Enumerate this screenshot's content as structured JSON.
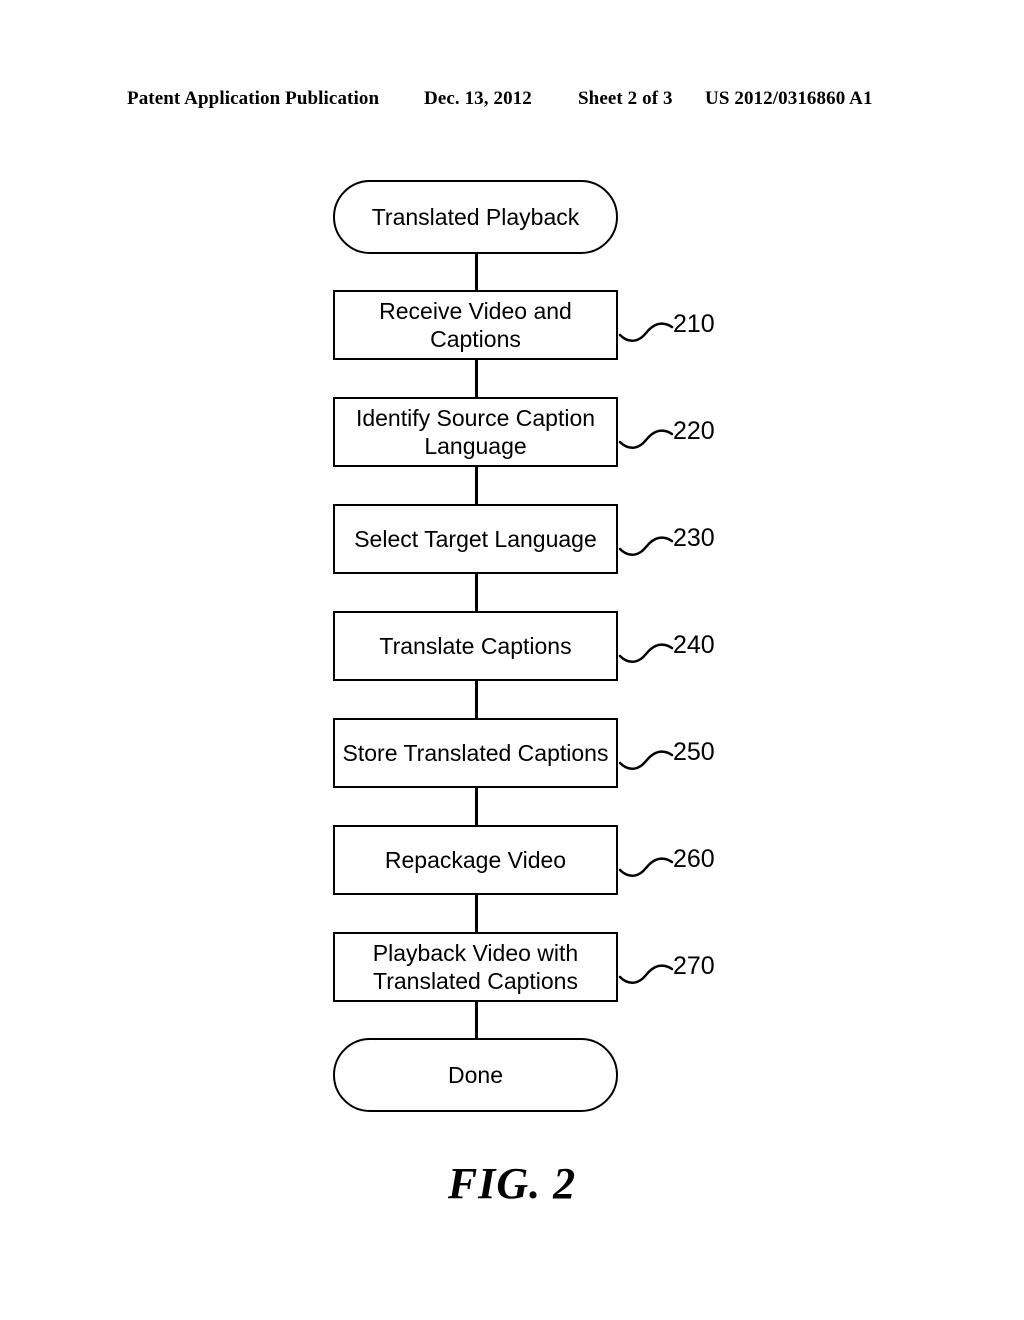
{
  "page": {
    "background_color": "#ffffff",
    "ink_color": "#000000"
  },
  "header": {
    "publication": "Patent Application Publication",
    "date": "Dec. 13, 2012",
    "sheet": "Sheet 2 of 3",
    "document_number": "US 2012/0316860 A1"
  },
  "figure": {
    "caption": "FIG. 2",
    "title": "Translated Playback"
  },
  "flowchart": {
    "type": "flowchart",
    "orientation": "vertical",
    "nodes": [
      {
        "id": "start",
        "shape": "terminal",
        "label": "Translated Playback",
        "ref": null
      },
      {
        "id": "n210",
        "shape": "process",
        "label": "Receive Video and\nCaptions",
        "ref": "210"
      },
      {
        "id": "n220",
        "shape": "process",
        "label": "Identify Source Caption\nLanguage",
        "ref": "220"
      },
      {
        "id": "n230",
        "shape": "process",
        "label": "Select Target Language",
        "ref": "230"
      },
      {
        "id": "n240",
        "shape": "process",
        "label": "Translate Captions",
        "ref": "240"
      },
      {
        "id": "n250",
        "shape": "process",
        "label": "Store Translated Captions",
        "ref": "250"
      },
      {
        "id": "n260",
        "shape": "process",
        "label": "Repackage Video",
        "ref": "260"
      },
      {
        "id": "n270",
        "shape": "process",
        "label": "Playback Video with\nTranslated Captions",
        "ref": "270"
      },
      {
        "id": "end",
        "shape": "terminal",
        "label": "Done",
        "ref": null
      }
    ],
    "edges": [
      {
        "from": "start",
        "to": "n210"
      },
      {
        "from": "n210",
        "to": "n220"
      },
      {
        "from": "n220",
        "to": "n230"
      },
      {
        "from": "n230",
        "to": "n240"
      },
      {
        "from": "n240",
        "to": "n250"
      },
      {
        "from": "n250",
        "to": "n260"
      },
      {
        "from": "n260",
        "to": "n270"
      },
      {
        "from": "n270",
        "to": "end"
      }
    ]
  }
}
